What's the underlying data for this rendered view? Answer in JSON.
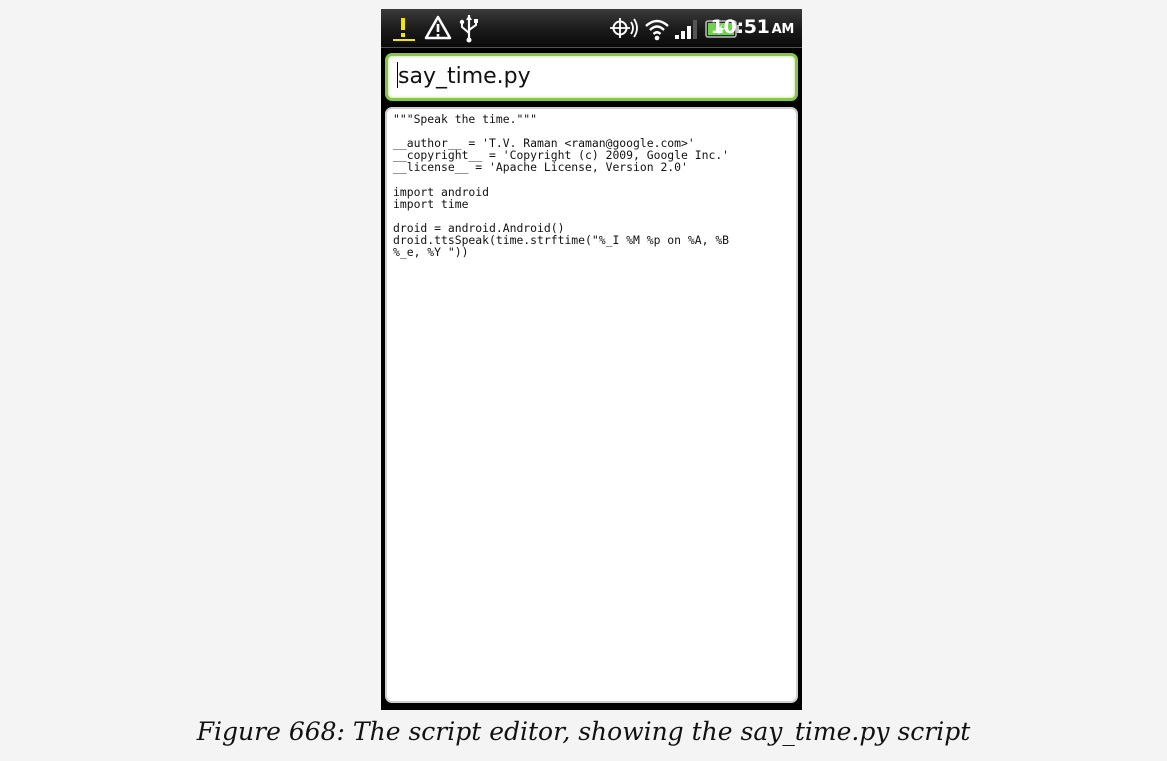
{
  "status_bar": {
    "icons": [
      "notification-icon",
      "warning-icon",
      "usb-icon",
      "gps-icon",
      "wifi-icon",
      "signal-icon",
      "battery-icon"
    ],
    "time": "10:51",
    "ampm": "AM"
  },
  "editor": {
    "filename": "say_time.py",
    "code": "\"\"\"Speak the time.\"\"\"\n\n__author__ = 'T.V. Raman <raman@google.com>'\n__copyright__ = 'Copyright (c) 2009, Google Inc.'\n__license__ = 'Apache License, Version 2.0'\n\nimport android\nimport time\n\ndroid = android.Android()\ndroid.ttsSpeak(time.strftime(\"%_I %M %p on %A, %B\n%_e, %Y \"))"
  },
  "caption": "Figure 668: The script editor, showing the say_time.py script",
  "colors": {
    "filename_border": "#8ac54b",
    "status_bar_bg": "#1a1a1a",
    "battery_fill": "#6fd24a",
    "notification_icon": "#f2e500"
  }
}
